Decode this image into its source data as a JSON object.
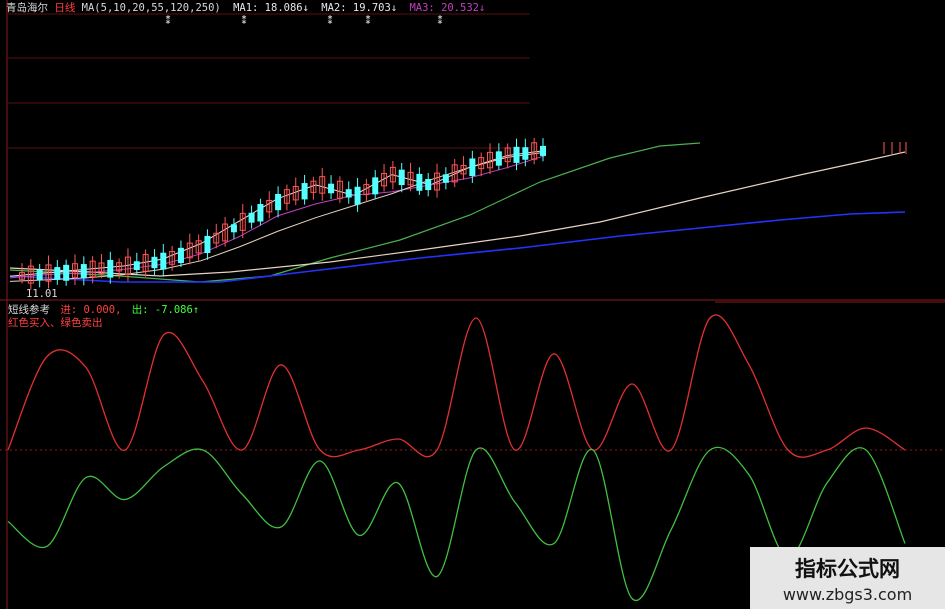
{
  "header": {
    "stock": "青岛海尔",
    "period": "日线",
    "ma_params": "MA(5,10,20,55,120,250)",
    "ma1": "MA1: 18.086",
    "ma2": "MA2: 19.703",
    "ma3": "MA3: 20.532",
    "date_label": "11.01"
  },
  "indicator": {
    "name": "短线参考",
    "in_label": "进: 0.000,",
    "out_label": "出: -7.086",
    "legend": "红色买入、绿色卖出"
  },
  "watermark": {
    "title": "指标公式网",
    "url": "www.zbgs3.com"
  },
  "colors": {
    "background": "#000000",
    "axis_red": "#8b1a1a",
    "up_candle": "#ff5555",
    "down_candle": "#55ffff",
    "ma_white": "#e8e8e8",
    "ma_purple": "#c040c0",
    "ma_green": "#4caf50",
    "ma_pale": "#e6d3c0",
    "ma_blue": "#2233ff",
    "osc_up": "#e03030",
    "osc_down": "#40c040",
    "ma3_label": "#c040c0"
  },
  "chart_data": [
    {
      "type": "candlestick",
      "title": "青岛海尔 日线",
      "series": [
        {
          "name": "MA1",
          "values": [
            13.3,
            13.5,
            13.7,
            13.9,
            14.3,
            15.2,
            16.5,
            17.8,
            18.6,
            18.0,
            19.2,
            18.6,
            19.6,
            20.3,
            20.6
          ]
        },
        {
          "name": "MA2",
          "values": [
            13.2,
            13.4,
            13.5,
            13.7,
            14.0,
            14.6,
            15.6,
            16.8,
            17.5,
            18.0,
            18.2,
            18.6,
            19.0,
            19.6,
            20.3
          ]
        },
        {
          "name": "MA3",
          "values": [
            13.0,
            13.1,
            13.2,
            13.4,
            13.7,
            14.2,
            15.0,
            15.9,
            16.7,
            17.4,
            18.1,
            18.9,
            19.6,
            20.2,
            20.5
          ]
        }
      ]
    },
    {
      "type": "line",
      "title": "短线参考",
      "series": [
        {
          "name": "进",
          "values": [
            0,
            3.4,
            3.0,
            0,
            4.2,
            2.5,
            0,
            3.1,
            0,
            0,
            0.4,
            0,
            4.8,
            0,
            3.5,
            0,
            2.4,
            0,
            4.8,
            3.1,
            0,
            0,
            0.8,
            0
          ]
        },
        {
          "name": "出",
          "values": [
            -2.6,
            -3.5,
            -1.0,
            -1.8,
            -0.6,
            0,
            -1.6,
            -2.8,
            -0.4,
            -3.1,
            -1.2,
            -4.6,
            0,
            -1.9,
            -3.4,
            0,
            -5.4,
            -2.9,
            0,
            -0.9,
            -3.9,
            -1.2,
            0,
            -3.4
          ]
        }
      ]
    }
  ]
}
